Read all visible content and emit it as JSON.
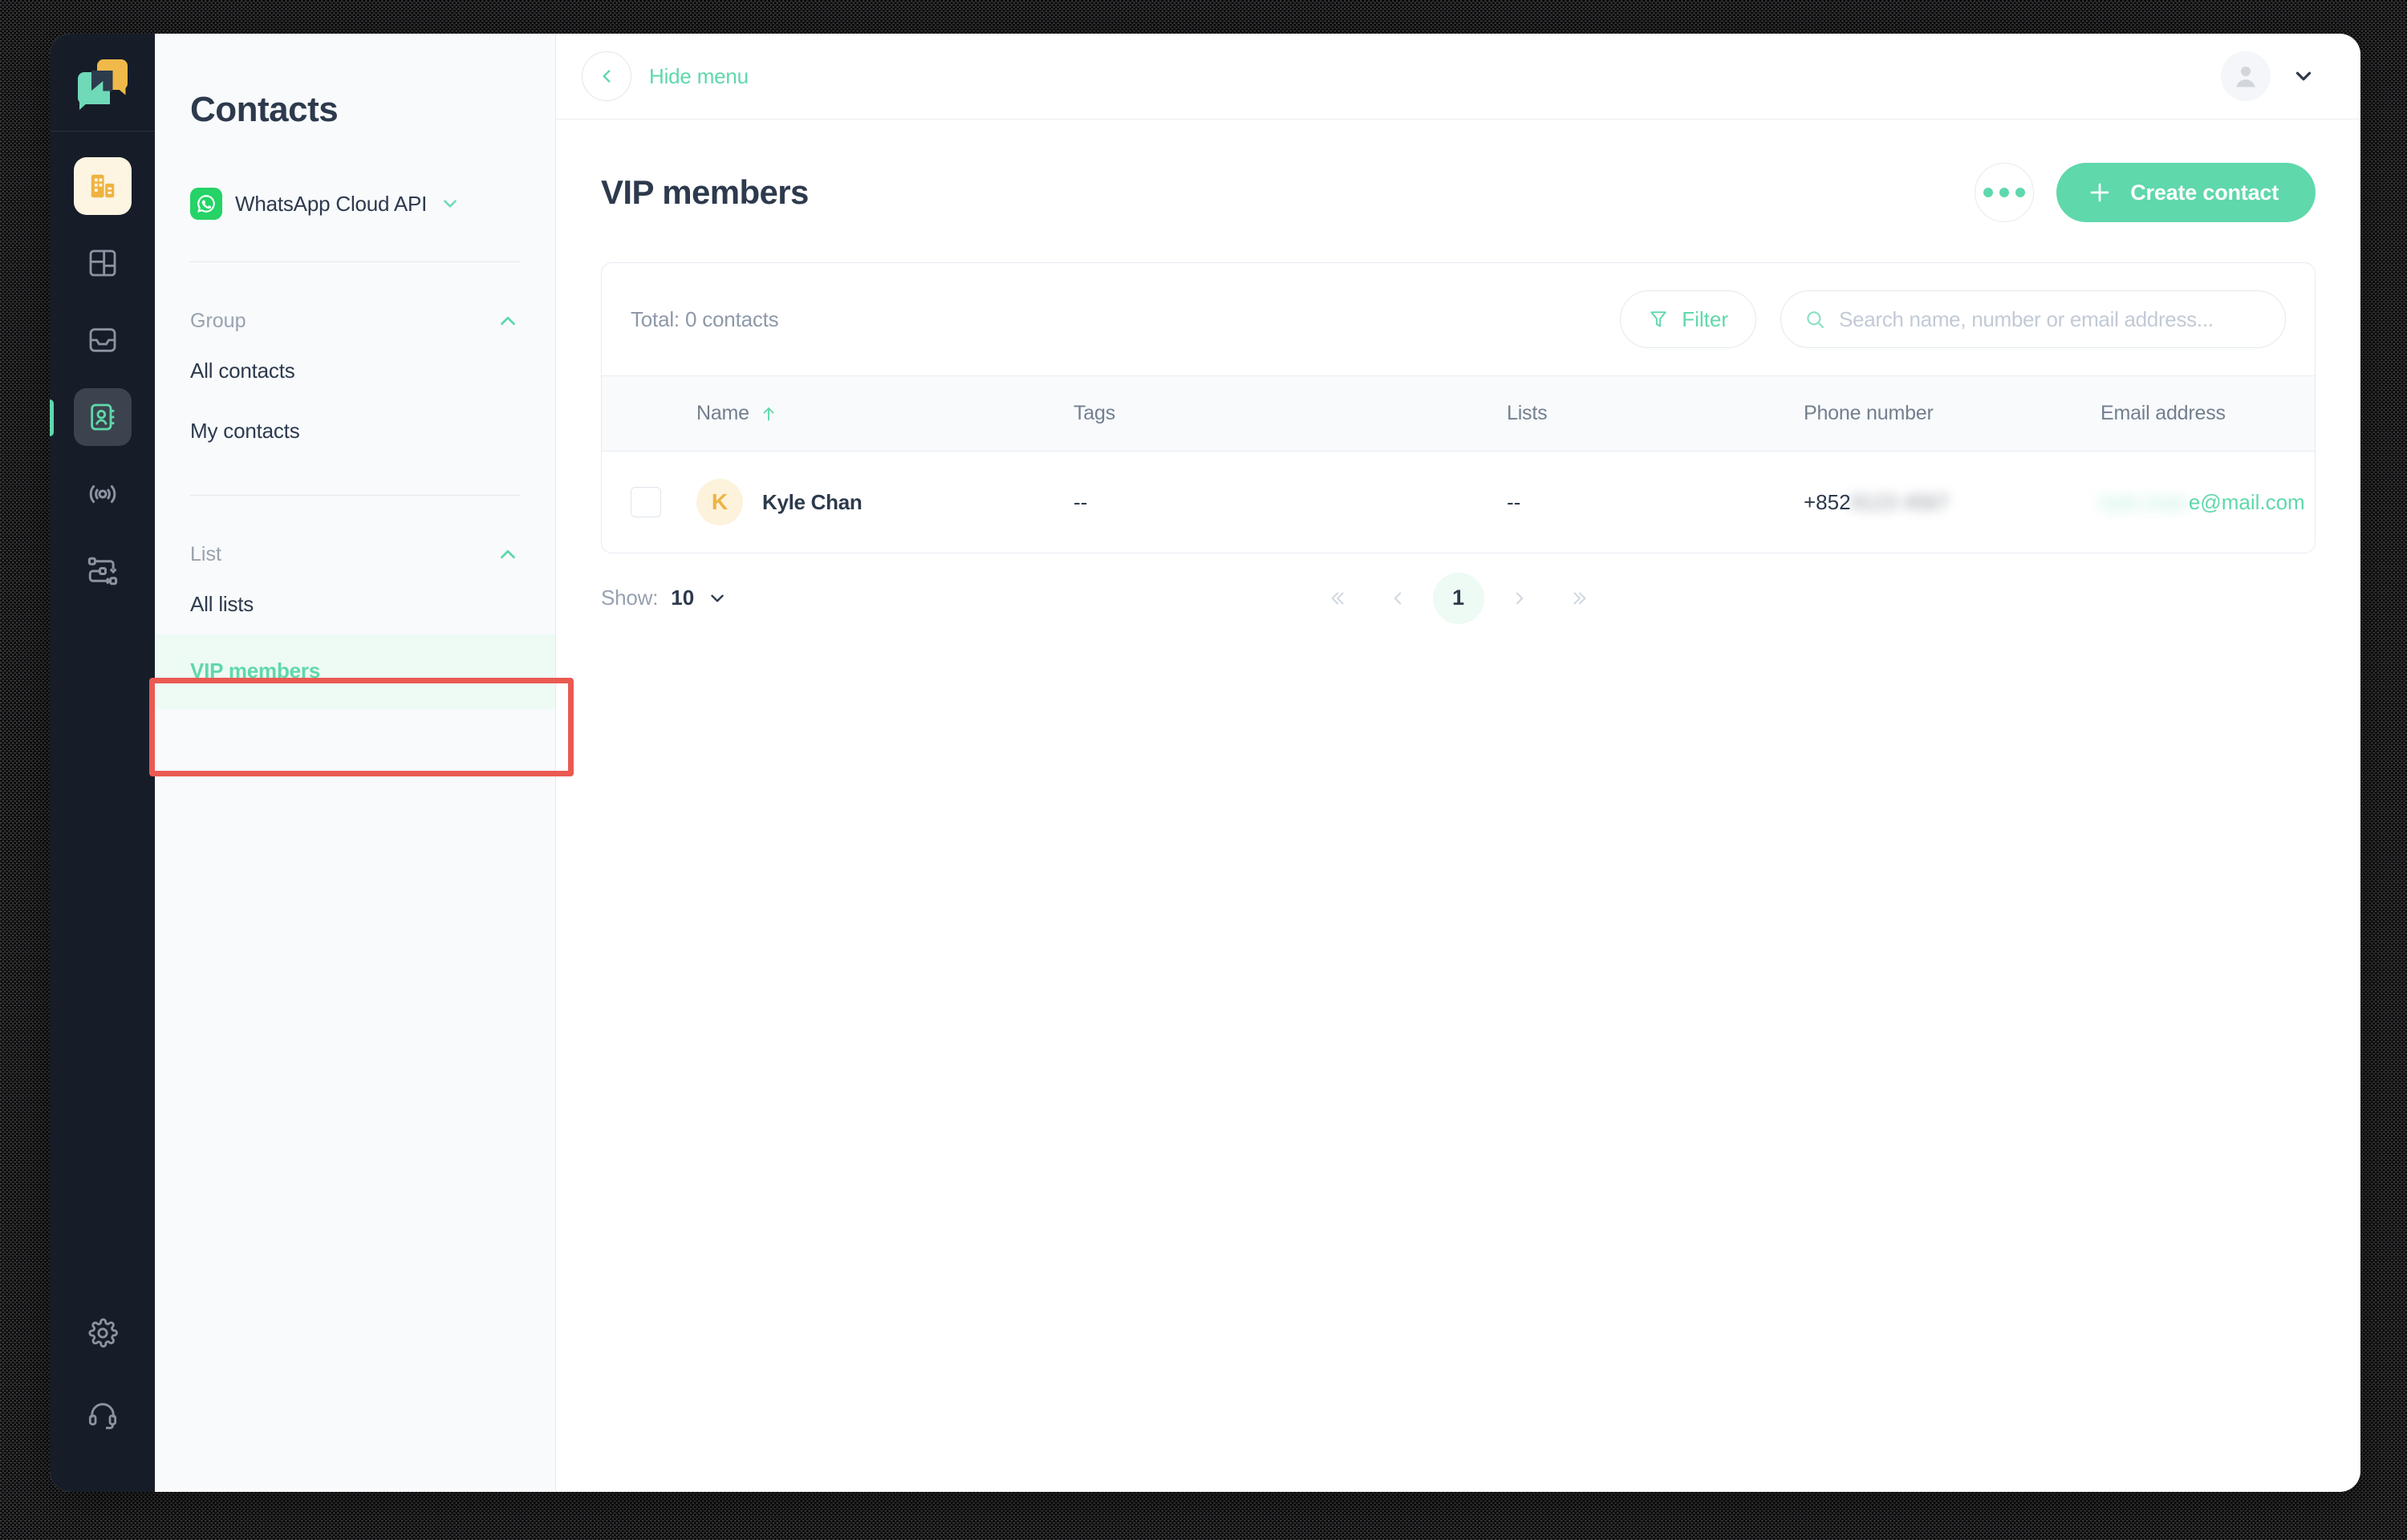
{
  "window": {
    "panel_title": "Contacts"
  },
  "rail": {
    "logo": "yoov-logo-icon",
    "items": [
      {
        "name": "company-icon",
        "label": "Company"
      },
      {
        "name": "dashboard-icon",
        "label": "Dashboard"
      },
      {
        "name": "inbox-icon",
        "label": "Inbox"
      },
      {
        "name": "contacts-icon",
        "label": "Contacts"
      },
      {
        "name": "broadcast-icon",
        "label": "Broadcast"
      },
      {
        "name": "workflow-icon",
        "label": "Workflow"
      }
    ],
    "bottom_items": [
      {
        "name": "gear-icon",
        "label": "Settings"
      },
      {
        "name": "headset-icon",
        "label": "Support"
      }
    ]
  },
  "panel": {
    "channel": "WhatsApp Cloud API",
    "channel_icon": "whatsapp-icon",
    "sections": [
      {
        "label": "Group",
        "collapsed": false,
        "items": [
          {
            "label": "All contacts",
            "selected": false
          },
          {
            "label": "My contacts",
            "selected": false
          }
        ]
      },
      {
        "label": "List",
        "collapsed": false,
        "items": [
          {
            "label": "All lists",
            "selected": false
          },
          {
            "label": "VIP members",
            "selected": true
          }
        ]
      }
    ]
  },
  "topbar": {
    "hide_menu_label": "Hide menu",
    "back_icon": "chevron-left-icon",
    "avatar_icon": "user-avatar-icon",
    "caret_icon": "chevron-down-icon"
  },
  "page": {
    "title": "VIP members",
    "more_label": "More options",
    "more_icon": "ellipsis-icon",
    "create_label": "Create contact",
    "create_icon": "plus-icon"
  },
  "toolbar": {
    "total": "Total: 0 contacts",
    "filter_label": "Filter",
    "filter_icon": "funnel-icon",
    "search_placeholder": "Search name, number or email address...",
    "search_value": "",
    "search_icon": "search-icon"
  },
  "table": {
    "columns": [
      "Name",
      "Tags",
      "Lists",
      "Phone number",
      "Email address"
    ],
    "sort_column": "Name",
    "sort_direction": "asc",
    "sort_icon": "arrow-up-icon",
    "rows": [
      {
        "checked": false,
        "initial": "K",
        "name": "Kyle Chan",
        "tags": "--",
        "lists": "--",
        "phone_prefix": "+852",
        "phone_masked": "9123 4567",
        "email_masked": "kyle.chan",
        "email_suffix": "e@mail.com"
      }
    ]
  },
  "pagination": {
    "show_label": "Show:",
    "show_value": "10",
    "show_caret": "chevron-down-icon",
    "first_icon": "double-chevron-left-icon",
    "prev_icon": "chevron-left-icon",
    "next_icon": "chevron-right-icon",
    "last_icon": "double-chevron-right-icon",
    "current_page": "1"
  },
  "colors": {
    "accent": "#5fd8ab",
    "dark": "#2d3a4d",
    "rail": "#161d28",
    "highlight_box": "#ea5a52",
    "avatar_yellow": "#eeb342",
    "whatsapp_green": "#25d366"
  }
}
